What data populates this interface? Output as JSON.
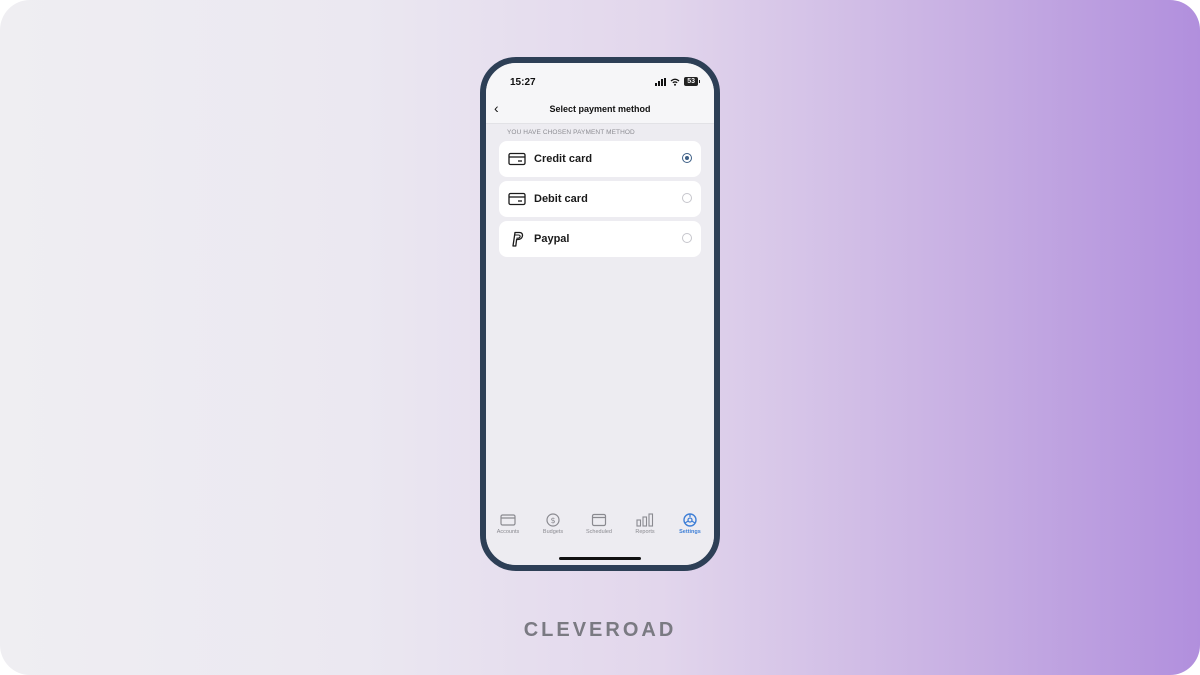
{
  "status_bar": {
    "time": "15:27",
    "battery": "53"
  },
  "header": {
    "back_icon": "chevron-left-icon",
    "title": "Select payment method"
  },
  "section": {
    "title": "YOU HAVE CHOSEN PAYMENT METHOD"
  },
  "payment_options": [
    {
      "label": "Credit card",
      "icon": "credit-card-icon",
      "selected": true
    },
    {
      "label": "Debit card",
      "icon": "credit-card-icon",
      "selected": false
    },
    {
      "label": "Paypal",
      "icon": "paypal-icon",
      "selected": false
    }
  ],
  "tabs": [
    {
      "label": "Accounts",
      "icon": "wallet-icon",
      "active": false
    },
    {
      "label": "Budgets",
      "icon": "dollar-circle-icon",
      "active": false
    },
    {
      "label": "Scheduled",
      "icon": "calendar-icon",
      "active": false
    },
    {
      "label": "Reports",
      "icon": "bar-chart-icon",
      "active": false
    },
    {
      "label": "Settings",
      "icon": "gear-icon",
      "active": true
    }
  ],
  "brand": "CLEVEROAD",
  "colors": {
    "accent": "#3f7fd6",
    "radio_selected": "#3d5f86",
    "phone_frame": "#2d3f56"
  }
}
